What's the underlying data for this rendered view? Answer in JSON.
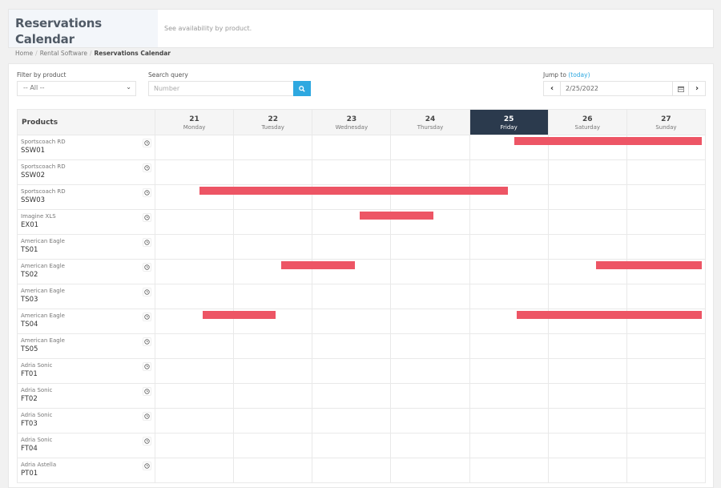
{
  "header": {
    "title": "Reservations Calendar",
    "subtitle": "See availability by product.",
    "breadcrumb": [
      "Home",
      "Rental Software",
      "Reservations Calendar"
    ]
  },
  "filters": {
    "product_label": "Filter by product",
    "product_value": "-- All --",
    "search_label": "Search query",
    "search_placeholder": "Number",
    "jump_label": "Jump to",
    "today_link": "(today)",
    "date_value": "2/25/2022"
  },
  "colors": {
    "accent": "#2ea8e0",
    "reservation": "#ed5565",
    "today_header": "#2b3a4d"
  },
  "calendar": {
    "products_header": "Products",
    "today_index": 4,
    "days": [
      {
        "num": "21",
        "name": "Monday"
      },
      {
        "num": "22",
        "name": "Tuesday"
      },
      {
        "num": "23",
        "name": "Wednesday"
      },
      {
        "num": "24",
        "name": "Thursday"
      },
      {
        "num": "25",
        "name": "Friday"
      },
      {
        "num": "26",
        "name": "Saturday"
      },
      {
        "num": "27",
        "name": "Sunday"
      }
    ],
    "rows": [
      {
        "model": "Sportscoach RD",
        "code": "SSW01",
        "reservations": [
          {
            "start": 4.57,
            "end": 7.0
          }
        ]
      },
      {
        "model": "Sportscoach RD",
        "code": "SSW02",
        "reservations": []
      },
      {
        "model": "Sportscoach RD",
        "code": "SSW03",
        "reservations": [
          {
            "start": 0.57,
            "end": 4.53
          }
        ]
      },
      {
        "model": "Imagine XLS",
        "code": "EX01",
        "reservations": [
          {
            "start": 2.61,
            "end": 3.59
          }
        ]
      },
      {
        "model": "American Eagle",
        "code": "TS01",
        "reservations": []
      },
      {
        "model": "American Eagle",
        "code": "TS02",
        "reservations": [
          {
            "start": 1.61,
            "end": 2.59
          },
          {
            "start": 5.61,
            "end": 7.0
          }
        ]
      },
      {
        "model": "American Eagle",
        "code": "TS03",
        "reservations": []
      },
      {
        "model": "American Eagle",
        "code": "TS04",
        "reservations": [
          {
            "start": 0.61,
            "end": 1.58
          },
          {
            "start": 4.61,
            "end": 7.0
          }
        ]
      },
      {
        "model": "American Eagle",
        "code": "TS05",
        "reservations": []
      },
      {
        "model": "Adria Sonic",
        "code": "FT01",
        "reservations": []
      },
      {
        "model": "Adria Sonic",
        "code": "FT02",
        "reservations": []
      },
      {
        "model": "Adria Sonic",
        "code": "FT03",
        "reservations": []
      },
      {
        "model": "Adria Sonic",
        "code": "FT04",
        "reservations": []
      },
      {
        "model": "Adria Astella",
        "code": "PT01",
        "reservations": []
      }
    ]
  }
}
